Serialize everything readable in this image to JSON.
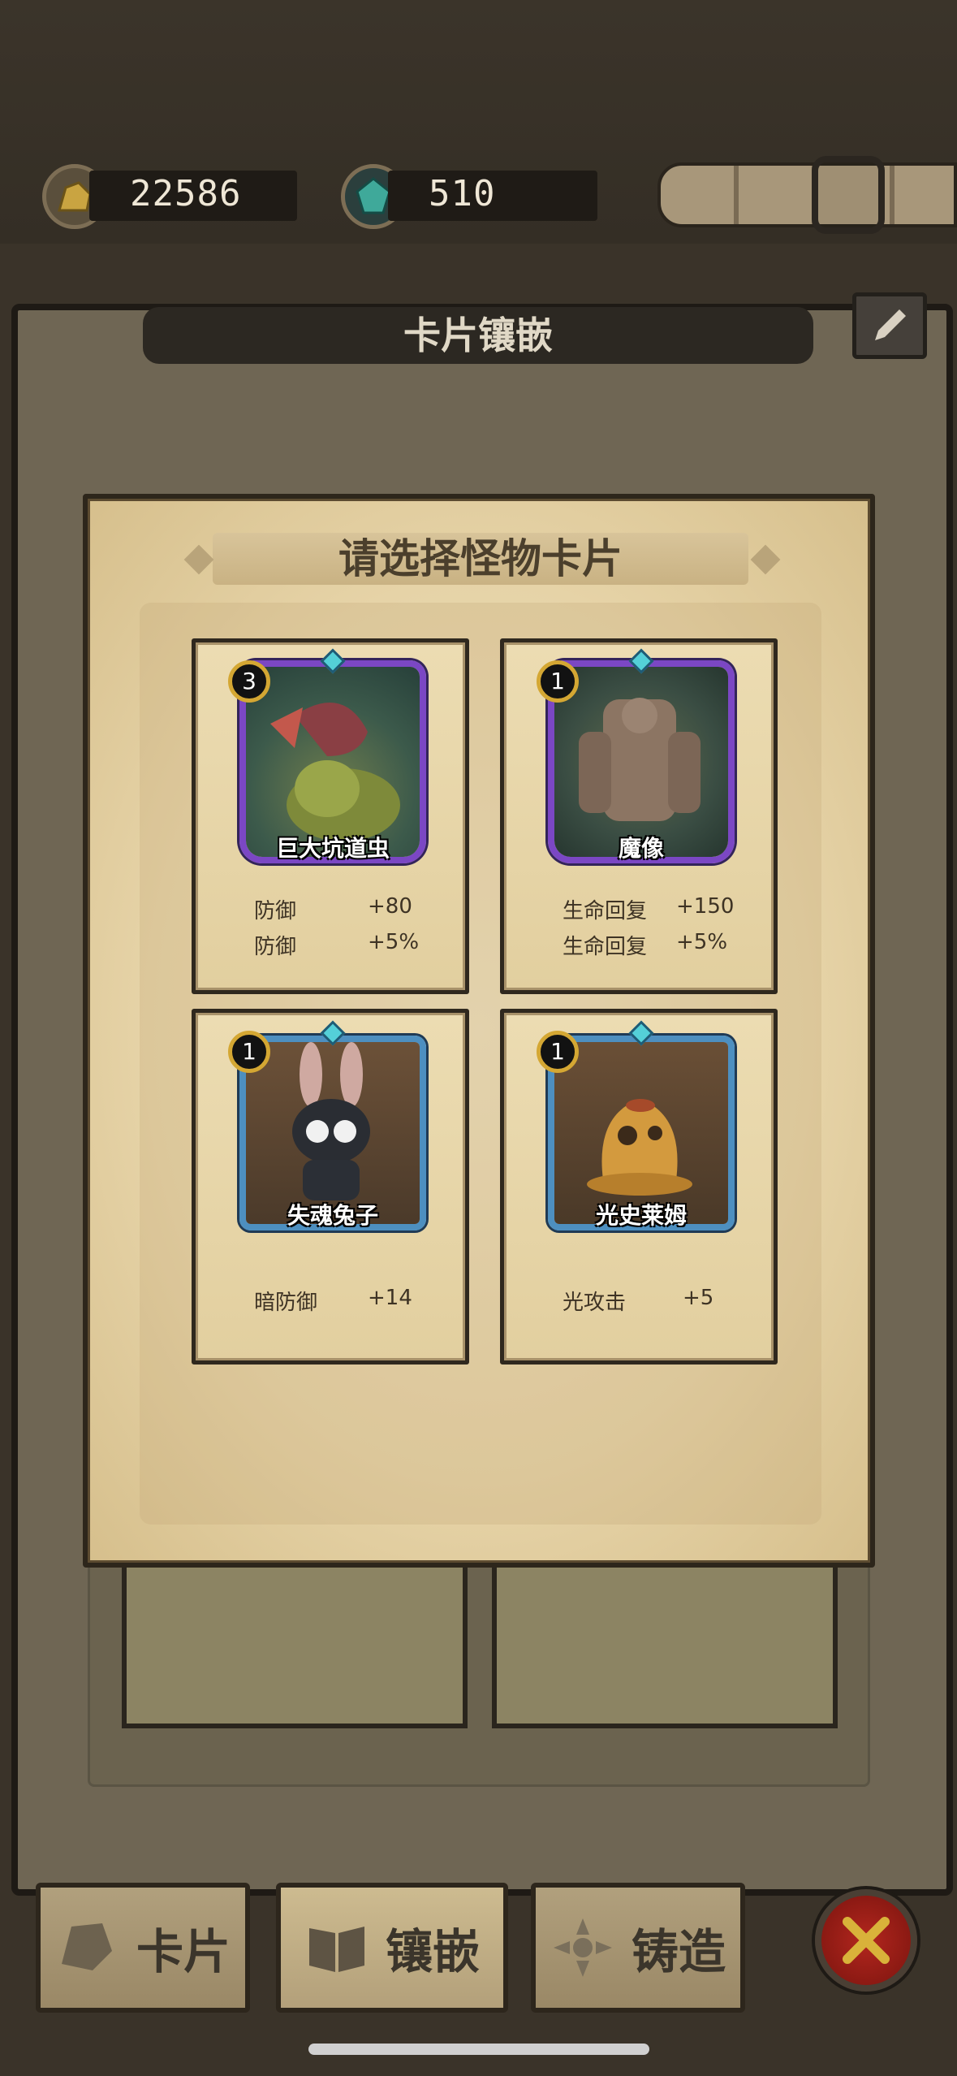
{
  "resources": {
    "gold": "22586",
    "gems": "510"
  },
  "panel": {
    "title": "卡片镶嵌"
  },
  "popup": {
    "title": "请选择怪物卡片",
    "cards": [
      {
        "name": "巨大坑道虫",
        "level": "3",
        "frame": "purple",
        "stats": [
          {
            "label": "防御",
            "value": "+80"
          },
          {
            "label": "防御",
            "value": "+5%"
          }
        ]
      },
      {
        "name": "魔像",
        "level": "1",
        "frame": "purple",
        "stats": [
          {
            "label": "生命回复",
            "value": "+150"
          },
          {
            "label": "生命回复",
            "value": "+5%"
          }
        ]
      },
      {
        "name": "失魂兔子",
        "level": "1",
        "frame": "blue",
        "stats": [
          {
            "label": "暗防御",
            "value": "+14"
          }
        ]
      },
      {
        "name": "光史莱姆",
        "level": "1",
        "frame": "blue",
        "stats": [
          {
            "label": "光攻击",
            "value": "+5"
          }
        ]
      }
    ]
  },
  "tabs": [
    {
      "label": "卡片",
      "icon": "cards-icon"
    },
    {
      "label": "镶嵌",
      "icon": "book-icon"
    },
    {
      "label": "铸造",
      "icon": "forge-icon"
    }
  ],
  "colors": {
    "purple_frame": "#7b47c4",
    "blue_frame": "#4d8fc0",
    "close_red": "#b3261e",
    "level_ring": "#d4a733"
  }
}
